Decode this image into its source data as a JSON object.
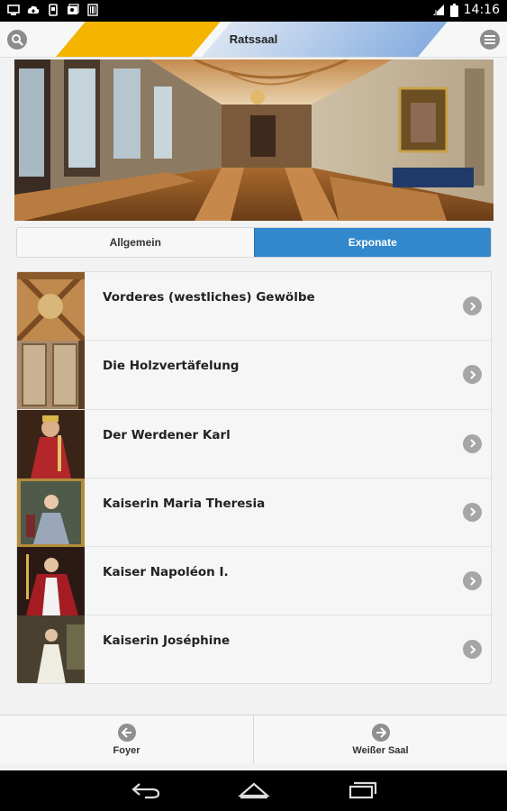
{
  "status_bar": {
    "time": "14:16",
    "icons_left": [
      "screen-icon",
      "cloud-upload-icon",
      "phone-icon",
      "photo-icon",
      "barcode-icon"
    ],
    "icons_right": [
      "signal-icon",
      "battery-icon"
    ]
  },
  "header": {
    "title": "Ratssaal",
    "search_icon": "search-icon",
    "menu_icon": "menu-icon",
    "colors": {
      "yellow": "#f4b400",
      "blue": "#88aee0"
    }
  },
  "tabs": [
    {
      "label": "Allgemein",
      "active": false
    },
    {
      "label": "Exponate",
      "active": true
    }
  ],
  "accent_color": "#3388cc",
  "exhibits": [
    {
      "label": "Vorderes (westliches) Gewölbe"
    },
    {
      "label": "Die Holzvertäfelung"
    },
    {
      "label": "Der Werdener Karl"
    },
    {
      "label": "Kaiserin Maria Theresia"
    },
    {
      "label": "Kaiser Napoléon I."
    },
    {
      "label": "Kaiserin Joséphine"
    }
  ],
  "bottom_nav": {
    "prev": {
      "label": "Foyer",
      "icon": "arrow-left-icon"
    },
    "next": {
      "label": "Weißer Saal",
      "icon": "arrow-right-icon"
    }
  },
  "system_nav": [
    "back-icon",
    "home-icon",
    "recents-icon"
  ]
}
